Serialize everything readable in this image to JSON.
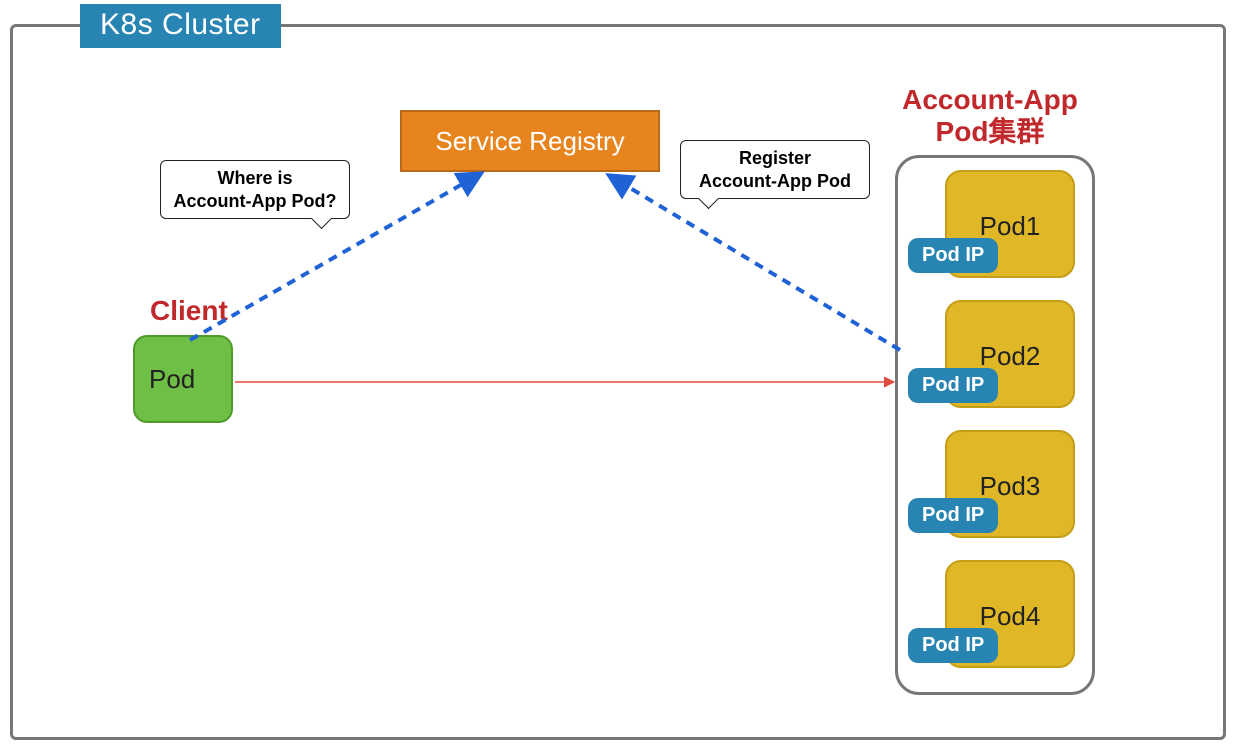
{
  "cluster_title": "K8s Cluster",
  "service_registry_label": "Service Registry",
  "client_label": "Client",
  "client_pod_label": "Pod",
  "account_app_title_line1": "Account-App",
  "account_app_title_line2": "Pod集群",
  "pods": [
    {
      "name": "Pod1",
      "ip_label": "Pod IP"
    },
    {
      "name": "Pod2",
      "ip_label": "Pod IP"
    },
    {
      "name": "Pod3",
      "ip_label": "Pod IP"
    },
    {
      "name": "Pod4",
      "ip_label": "Pod IP"
    }
  ],
  "bubble_left_line1": "Where is",
  "bubble_left_line2": "Account-App Pod?",
  "bubble_right_line1": "Register",
  "bubble_right_line2": "Account-App Pod",
  "colors": {
    "cluster_title_bg": "#2784b3",
    "service_registry_bg": "#e7841e",
    "client_pod_bg": "#6fbe46",
    "pod_bg": "#e0b827",
    "pod_ip_bg": "#2784b3",
    "heading_red": "#c1282b",
    "arrow_blue": "#1f62d6",
    "arrow_red": "#e04a3f"
  }
}
